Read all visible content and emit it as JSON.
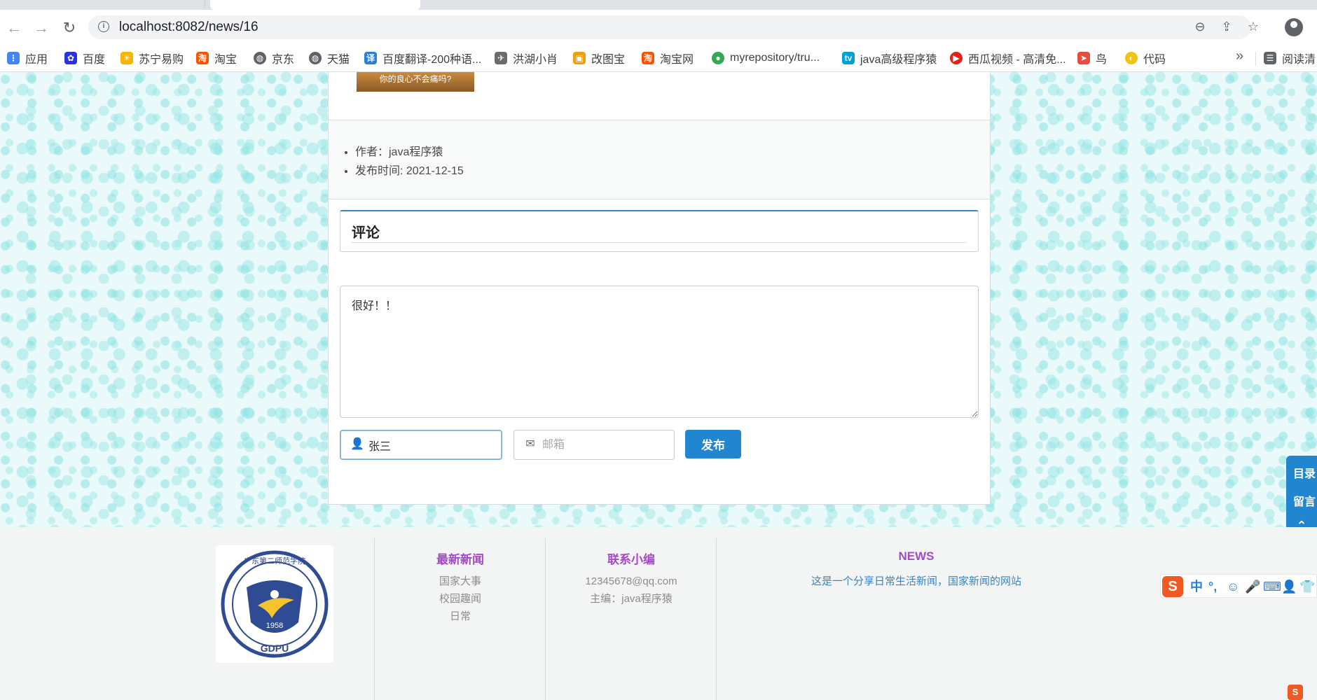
{
  "browser": {
    "url": "localhost:8082/news/16",
    "bookmarks": [
      {
        "label": "应用",
        "icon": "apps-grid-icon",
        "color": "#4285f4"
      },
      {
        "label": "百度",
        "icon": "baidu-paw-icon",
        "color": "#2932e1"
      },
      {
        "label": "苏宁易购",
        "icon": "suning-lion-icon",
        "color": "#f7b500"
      },
      {
        "label": "淘宝",
        "icon": "taobao-icon",
        "color": "#ff5000"
      },
      {
        "label": "京东",
        "icon": "globe-icon",
        "color": "#5f6368"
      },
      {
        "label": "天猫",
        "icon": "globe-icon",
        "color": "#5f6368"
      },
      {
        "label": "百度翻译-200种语...",
        "icon": "translate-icon",
        "color": "#2b7fd8"
      },
      {
        "label": "洪湖小肖",
        "icon": "bird-icon",
        "color": "#6b6b6b"
      },
      {
        "label": "改图宝",
        "icon": "image-editor-icon",
        "color": "#f39c12"
      },
      {
        "label": "淘宝网",
        "icon": "taobao-icon",
        "color": "#ff5000"
      },
      {
        "label": "myrepository/tru...",
        "icon": "repo-icon",
        "color": "#34a853"
      },
      {
        "label": "java高级程序猿",
        "icon": "bilibili-icon",
        "color": "#00a1d6"
      },
      {
        "label": "西瓜视频 - 高清免...",
        "icon": "video-play-icon",
        "color": "#e62117"
      },
      {
        "label": "鸟",
        "icon": "paper-plane-icon",
        "color": "#e74c3c"
      },
      {
        "label": "代码",
        "icon": "code-icon",
        "color": "#f1c40f"
      }
    ],
    "more_label": "»",
    "reading_list_label": "阅读清"
  },
  "article": {
    "image_caption": "你的良心不会痛吗?",
    "meta": {
      "author": "作者：java程序猿",
      "published": "发布时间: 2021-12-15"
    }
  },
  "comment": {
    "title": "评论",
    "content": "很好！！",
    "name_value": "张三",
    "email_placeholder": "邮箱",
    "submit_label": "发布"
  },
  "side_actions": {
    "catalog_label": "目录",
    "message_label": "留言"
  },
  "footer": {
    "col_news": {
      "title": "最新新闻",
      "items": [
        "国家大事",
        "校园趣闻",
        "日常"
      ]
    },
    "col_contact": {
      "title": "联系小编",
      "email": "12345678@qq.com",
      "editor": "主编：java程序猿"
    },
    "col_about": {
      "title": "NEWS",
      "desc": "这是一个分享日常生活新闻，国家新闻的网站"
    },
    "logo": {
      "text": "广东第二师范学院",
      "year": "1958",
      "abbr": "GDPU"
    }
  },
  "ime": {
    "logo": "S",
    "items": [
      "中",
      "°,",
      "☺",
      "🎤",
      "⌨",
      "👤",
      "👕"
    ]
  },
  "colors": {
    "accent_blue": "#2185d0",
    "footer_heading_purple": "#a649c9",
    "pattern_cyan": "#8ce2e2"
  }
}
